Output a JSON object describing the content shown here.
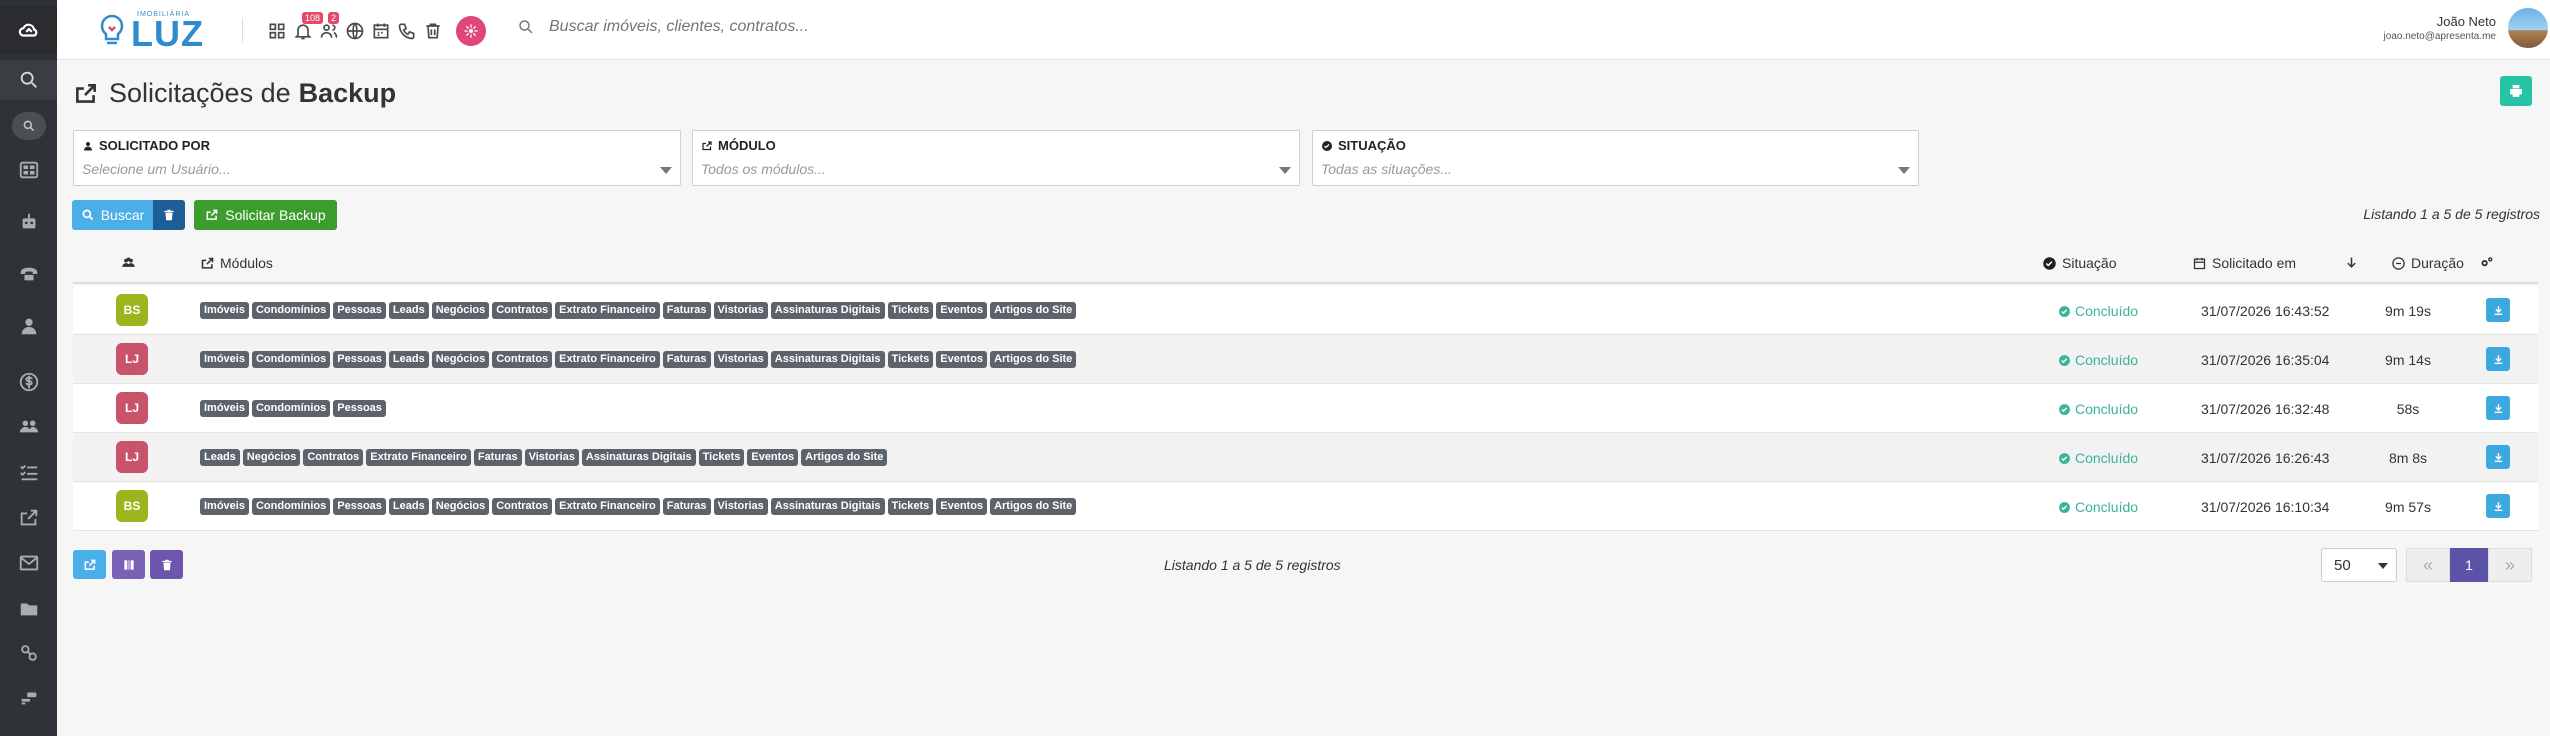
{
  "sidebar": {
    "items": [
      {
        "name": "home-cloud-icon"
      },
      {
        "name": "search-icon"
      },
      {
        "name": "search-pill-icon"
      },
      {
        "name": "dashboard-icon"
      },
      {
        "name": "robot-icon"
      },
      {
        "name": "phone-icon"
      },
      {
        "name": "user-icon"
      },
      {
        "name": "dollar-icon"
      },
      {
        "name": "users-icon"
      },
      {
        "name": "list-check-icon"
      },
      {
        "name": "share-icon"
      },
      {
        "name": "mail-icon"
      },
      {
        "name": "folder-icon"
      },
      {
        "name": "cogs-icon"
      },
      {
        "name": "gavel-icon"
      }
    ]
  },
  "topbar": {
    "logo_sub": "IMOBILIÁRIA",
    "logo_text": "LUZ",
    "notifications_badge": "108",
    "users_badge": "2",
    "search_placeholder": "Buscar imóveis, clientes, contratos...",
    "user_name": "João Neto",
    "user_email": "joao.neto@apresenta.me"
  },
  "page": {
    "title_prefix": "Solicitações de",
    "title_bold": "Backup"
  },
  "filters": {
    "requested_by": {
      "label": "SOLICITADO POR",
      "placeholder": "Selecione um Usuário..."
    },
    "module": {
      "label": "MÓDULO",
      "placeholder": "Todos os módulos..."
    },
    "status": {
      "label": "SITUAÇÃO",
      "placeholder": "Todas as situações..."
    }
  },
  "actions": {
    "search_label": "Buscar",
    "request_backup_label": "Solicitar Backup"
  },
  "listing_text": "Listando 1 a 5 de 5 registros",
  "table": {
    "headers": {
      "modules": "Módulos",
      "status": "Situação",
      "requested_at": "Solicitado em",
      "duration": "Duração"
    },
    "rows": [
      {
        "initials": "BS",
        "avatar_color": "#9bb51d",
        "modules": [
          "Imóveis",
          "Condomínios",
          "Pessoas",
          "Leads",
          "Negócios",
          "Contratos",
          "Extrato Financeiro",
          "Faturas",
          "Vistorias",
          "Assinaturas Digitais",
          "Tickets",
          "Eventos",
          "Artigos do Site"
        ],
        "status": "Concluído",
        "date": "31/07/2026 16:43:52",
        "duration": "9m 19s"
      },
      {
        "initials": "LJ",
        "avatar_color": "#c95469",
        "modules": [
          "Imóveis",
          "Condomínios",
          "Pessoas",
          "Leads",
          "Negócios",
          "Contratos",
          "Extrato Financeiro",
          "Faturas",
          "Vistorias",
          "Assinaturas Digitais",
          "Tickets",
          "Eventos",
          "Artigos do Site"
        ],
        "status": "Concluído",
        "date": "31/07/2026 16:35:04",
        "duration": "9m 14s"
      },
      {
        "initials": "LJ",
        "avatar_color": "#c95469",
        "modules": [
          "Imóveis",
          "Condomínios",
          "Pessoas"
        ],
        "status": "Concluído",
        "date": "31/07/2026 16:32:48",
        "duration": "58s"
      },
      {
        "initials": "LJ",
        "avatar_color": "#c95469",
        "modules": [
          "Leads",
          "Negócios",
          "Contratos",
          "Extrato Financeiro",
          "Faturas",
          "Vistorias",
          "Assinaturas Digitais",
          "Tickets",
          "Eventos",
          "Artigos do Site"
        ],
        "status": "Concluído",
        "date": "31/07/2026 16:26:43",
        "duration": "8m 8s"
      },
      {
        "initials": "BS",
        "avatar_color": "#9bb51d",
        "modules": [
          "Imóveis",
          "Condomínios",
          "Pessoas",
          "Leads",
          "Negócios",
          "Contratos",
          "Extrato Financeiro",
          "Faturas",
          "Vistorias",
          "Assinaturas Digitais",
          "Tickets",
          "Eventos",
          "Artigos do Site"
        ],
        "status": "Concluído",
        "date": "31/07/2026 16:10:34",
        "duration": "9m 57s"
      }
    ]
  },
  "pagination": {
    "page_size": "50",
    "current_page": "1",
    "first_symbol": "«",
    "last_symbol": "»"
  },
  "colors": {
    "sidebar_bg": "#2f3237",
    "buscar_blue": "#4aaee8",
    "solicitar_green": "#3c9d2c",
    "status_green": "#3bb39a",
    "pager_active": "#5b53a8",
    "print_teal": "#27c3a6"
  }
}
